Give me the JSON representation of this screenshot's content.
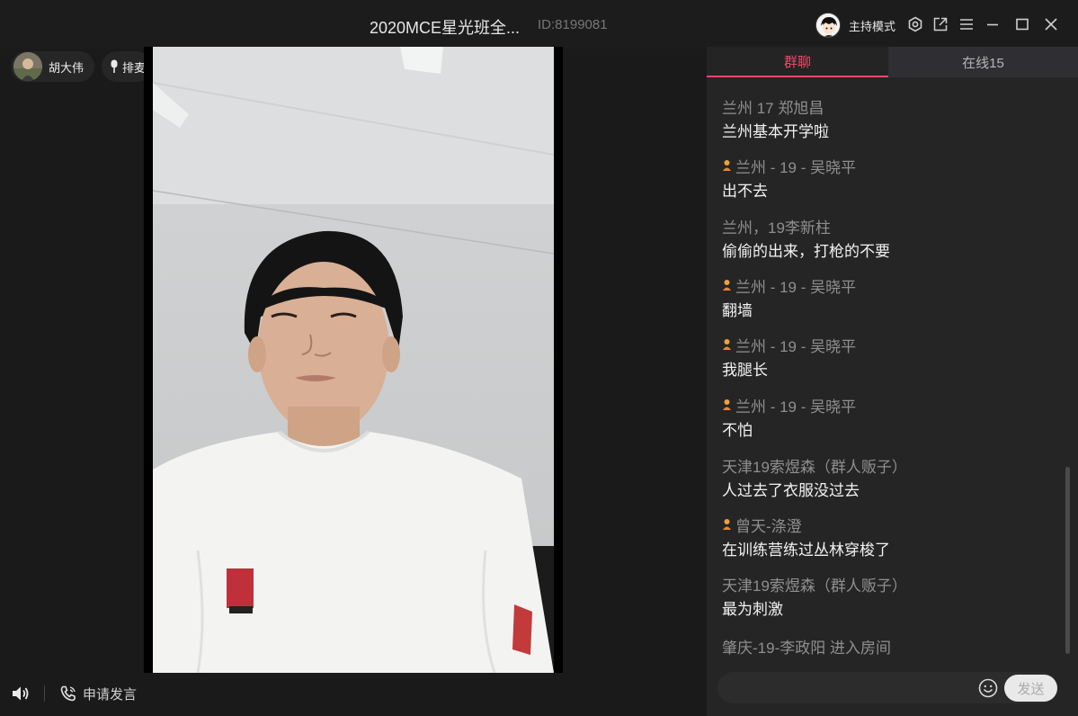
{
  "titlebar": {
    "title": "2020MCE星光班全...",
    "id_label": "ID:8199081",
    "mode": {
      "label": "主持模式",
      "icon": "host-avatar-icon"
    },
    "settings": {
      "icon": "gear-icon"
    },
    "popout": {
      "icon": "popout-icon"
    },
    "menu": {
      "icon": "menu-icon"
    },
    "minimize": {
      "icon": "minimize-icon"
    },
    "maximize": {
      "icon": "maximize-icon"
    },
    "close": {
      "icon": "close-icon"
    }
  },
  "left": {
    "host": {
      "name": "胡大伟",
      "icon": "avatar"
    },
    "queue": {
      "label": "排麦",
      "icon": "microphone-icon"
    },
    "video_scene": {
      "icon": "video-feed"
    },
    "speaker": {
      "icon": "speaker-icon"
    },
    "apply": {
      "label": "申请发言",
      "icon": "phone-icon"
    }
  },
  "chat": {
    "tabs": [
      {
        "label": "群聊",
        "active": true
      },
      {
        "label": "在线15",
        "active": false
      }
    ],
    "messages": [
      {
        "name": "兰州  17  郑旭昌",
        "text": "兰州基本开学啦",
        "badge": false
      },
      {
        "name": "兰州 - 19 - 吴晓平",
        "text": "出不去",
        "badge": true
      },
      {
        "name": "兰州，19李新柱",
        "text": "偷偷的出来，打枪的不要",
        "badge": false
      },
      {
        "name": "兰州 - 19 - 吴晓平",
        "text": "翻墙",
        "badge": true
      },
      {
        "name": "兰州 - 19 - 吴晓平",
        "text": "我腿长",
        "badge": true
      },
      {
        "name": "兰州 - 19 - 吴晓平",
        "text": "不怕",
        "badge": true
      },
      {
        "name": "天津19索煜森（群人贩子）",
        "text": "人过去了衣服没过去",
        "badge": false
      },
      {
        "name": "曾天-涤澄",
        "text": "在训练营练过丛林穿梭了",
        "badge": true
      },
      {
        "name": "天津19索煜森（群人贩子）",
        "text": "最为刺激",
        "badge": false
      }
    ],
    "system_message": "肇庆-19-李政阳 进入房间",
    "input": {
      "value": "",
      "placeholder": ""
    },
    "emoji": {
      "icon": "emoji-icon"
    },
    "send": {
      "label": "发送"
    },
    "accent_color": "#f0486a",
    "badge_color": "#e8862a"
  }
}
